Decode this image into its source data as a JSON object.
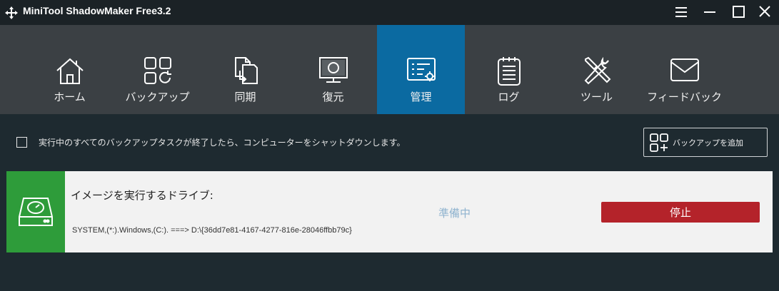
{
  "window": {
    "title": "MiniTool ShadowMaker Free3.2",
    "controls": [
      "menu-icon",
      "minimize-icon",
      "maximize-icon",
      "close-icon"
    ]
  },
  "nav": {
    "active": "管理",
    "items": [
      {
        "label": "ホーム",
        "icon": "home-icon"
      },
      {
        "label": "バックアップ",
        "icon": "backup-icon"
      },
      {
        "label": "同期",
        "icon": "sync-icon"
      },
      {
        "label": "復元",
        "icon": "restore-icon"
      },
      {
        "label": "管理",
        "icon": "manage-icon"
      },
      {
        "label": "ログ",
        "icon": "log-icon"
      },
      {
        "label": "ツール",
        "icon": "tools-icon"
      },
      {
        "label": "フィードバック",
        "icon": "feedback-icon"
      }
    ]
  },
  "main": {
    "shutdown_label": "実行中のすべてのバックアップタスクが終了したら、コンピューターをシャットダウンします。",
    "shutdown_checked": false,
    "add_backup_label": "バックアップを追加"
  },
  "task": {
    "title": "イメージを実行するドライブ:",
    "path": "SYSTEM,(*:).Windows,(C:). ===> D:\\{36dd7e81-4167-4277-816e-28046ffbb79c}",
    "status": "準備中",
    "stop_label": "停止",
    "icon": "drive-icon"
  },
  "colors": {
    "titlebar": "#1b2226",
    "navbar": "#3b4044",
    "nav_active": "#0b6aa1",
    "background": "#1e2a30",
    "task_icon_bg": "#2e9c3a",
    "stop_button": "#b4232a",
    "status_text": "#8fb3cf"
  }
}
